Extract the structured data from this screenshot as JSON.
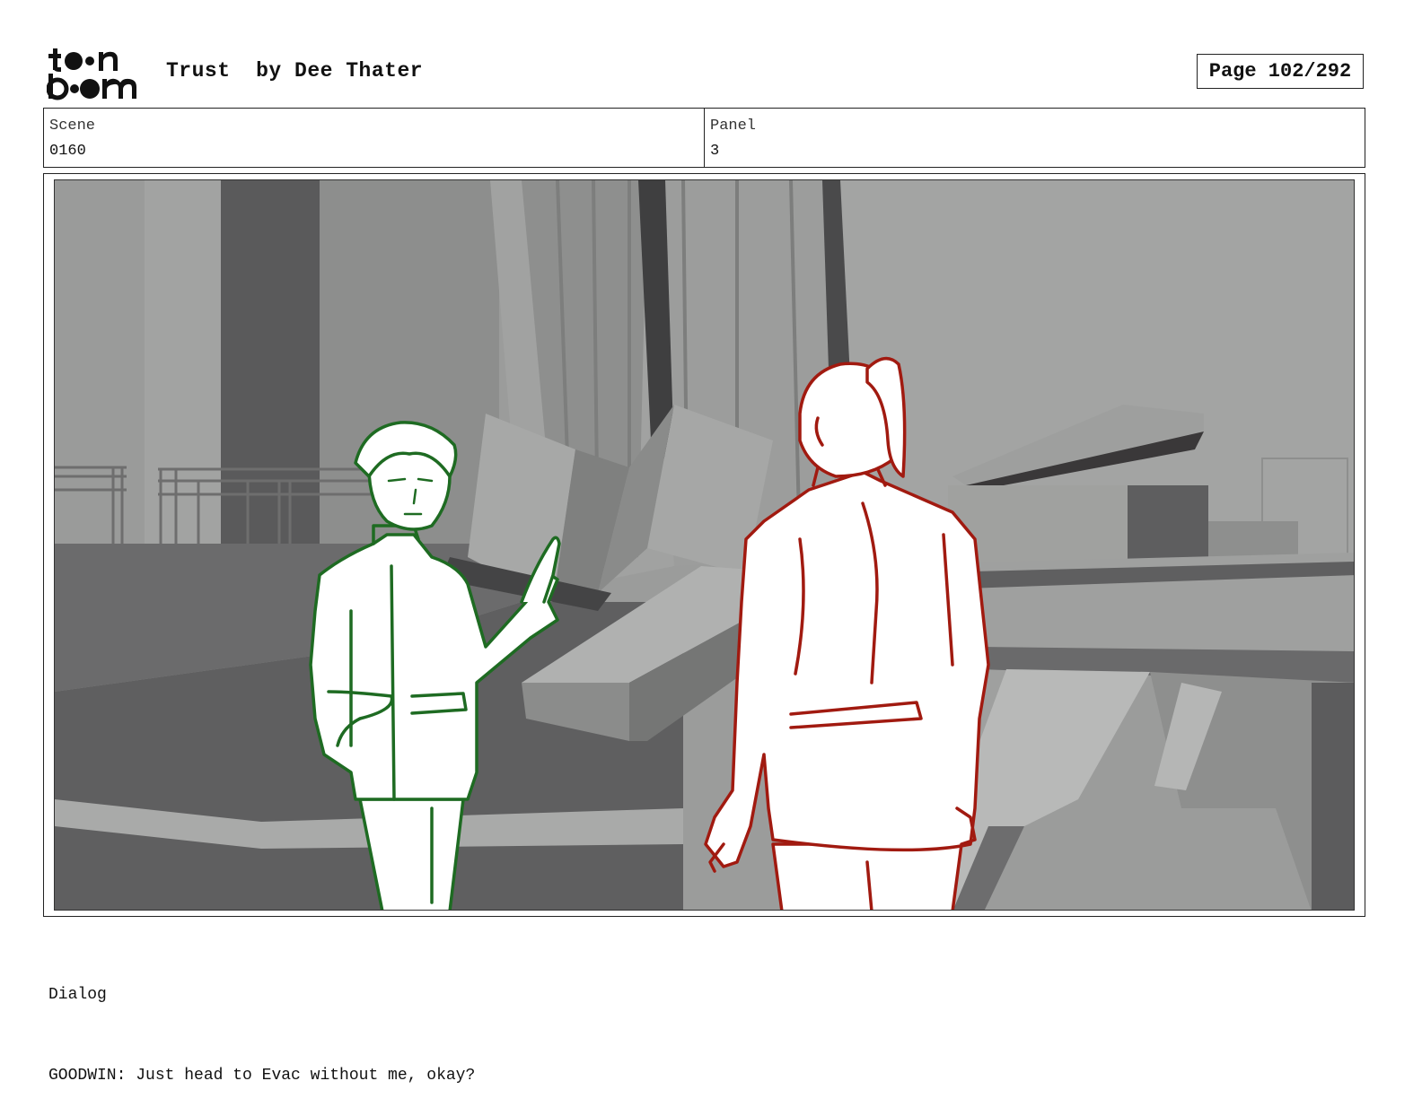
{
  "header": {
    "logo_text": "toon boom",
    "title": "Trust  by Dee Thater",
    "page_indicator": "Page 102/292"
  },
  "meta": {
    "scene_label": "Scene",
    "scene_value": "0160",
    "panel_label": "Panel",
    "panel_value": "3"
  },
  "panel_image": {
    "description_icon": "storyboard-sketch",
    "left_character_color": "#1e6b22",
    "right_character_color": "#a11a10"
  },
  "dialog": {
    "label": "Dialog",
    "text": "GOODWIN: Just head to Evac without me, okay?"
  }
}
